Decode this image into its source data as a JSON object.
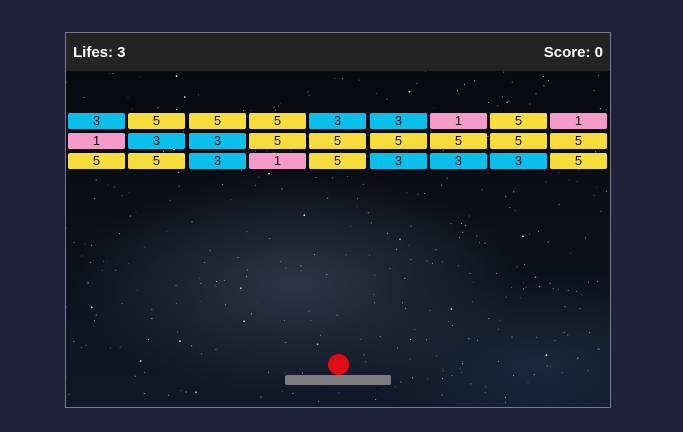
{
  "hud": {
    "lives_text": "Lifes: 3",
    "score_text": "Score: 0"
  },
  "colors": {
    "blue": "#0bbfeb",
    "yellow": "#f6dd3b",
    "pink": "#f59bc9",
    "ball": "#e00d16",
    "paddle": "#7d7d7d",
    "hud_bg": "#232323",
    "page_bg": "#20213a"
  },
  "bricks": [
    [
      {
        "value": "3",
        "color": "blue"
      },
      {
        "value": "5",
        "color": "yellow"
      },
      {
        "value": "5",
        "color": "yellow"
      },
      {
        "value": "5",
        "color": "yellow"
      },
      {
        "value": "3",
        "color": "blue"
      },
      {
        "value": "3",
        "color": "blue"
      },
      {
        "value": "1",
        "color": "pink"
      },
      {
        "value": "5",
        "color": "yellow"
      },
      {
        "value": "1",
        "color": "pink"
      }
    ],
    [
      {
        "value": "1",
        "color": "pink"
      },
      {
        "value": "3",
        "color": "blue"
      },
      {
        "value": "3",
        "color": "blue"
      },
      {
        "value": "5",
        "color": "yellow"
      },
      {
        "value": "5",
        "color": "yellow"
      },
      {
        "value": "5",
        "color": "yellow"
      },
      {
        "value": "5",
        "color": "yellow"
      },
      {
        "value": "5",
        "color": "yellow"
      },
      {
        "value": "5",
        "color": "yellow"
      }
    ],
    [
      {
        "value": "5",
        "color": "yellow"
      },
      {
        "value": "5",
        "color": "yellow"
      },
      {
        "value": "3",
        "color": "blue"
      },
      {
        "value": "1",
        "color": "pink"
      },
      {
        "value": "5",
        "color": "yellow"
      },
      {
        "value": "3",
        "color": "blue"
      },
      {
        "value": "3",
        "color": "blue"
      },
      {
        "value": "3",
        "color": "blue"
      },
      {
        "value": "5",
        "color": "yellow"
      }
    ]
  ]
}
